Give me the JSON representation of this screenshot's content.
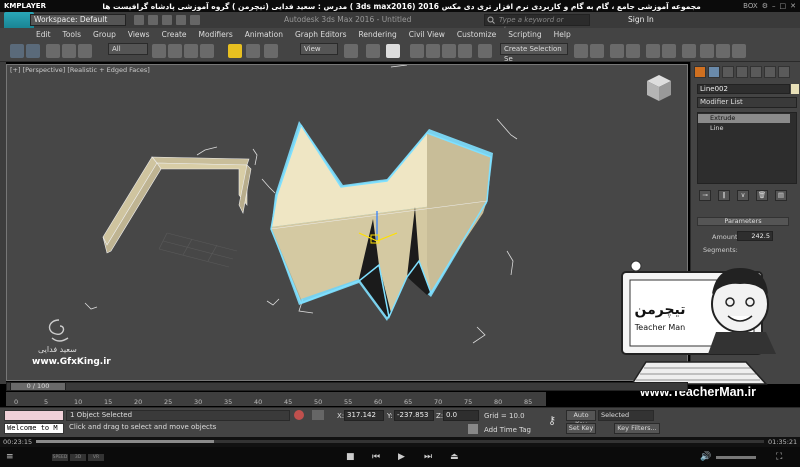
{
  "kmplayer": {
    "logo": "KMPLAYER",
    "video_title": "مجموعه آموزشی جامع ، گام به گام و کاربردی نرم افزار تری دی مکس 2016 (3ds max2016 ) مدرس : سعید فدایی (تیچرمن ) گروه آموزشی پادشاه گرافیست ها",
    "controls": [
      "BOX",
      "⚙",
      "–",
      "□",
      "✕"
    ],
    "time_elapsed": "00:23:15",
    "time_total": "01:35:21",
    "progress": 0.245,
    "chips": [
      "SPEED",
      "3D",
      "VR",
      "SUB"
    ]
  },
  "app": {
    "logo": "MAX",
    "workspace": "Workspace: Default",
    "title": "Autodesk 3ds Max 2016 - Untitled",
    "search_placeholder": "Type a keyword or phrase",
    "sign_in": "Sign In"
  },
  "menu": [
    "Edit",
    "Tools",
    "Group",
    "Views",
    "Create",
    "Modifiers",
    "Animation",
    "Graph Editors",
    "Rendering",
    "Civil View",
    "Customize",
    "Scripting",
    "Help"
  ],
  "toolbar": {
    "filter": "All",
    "coord_system": "View",
    "named_selection": "Create Selection Se"
  },
  "viewport": {
    "label": "[+] [Perspective] [Realistic + Edged Faces]"
  },
  "command_panel": {
    "object_name": "Line002",
    "modifier_list": "Modifier List",
    "stack": [
      "Extrude",
      "Line"
    ],
    "parameters_header": "Parameters",
    "amount_label": "Amount:",
    "amount_value": "242.5",
    "segments_label": "Segments:"
  },
  "timeline": {
    "frame_display": "0 / 100",
    "ticks": [
      "0",
      "5",
      "10",
      "15",
      "20",
      "25",
      "30",
      "35",
      "40",
      "45",
      "50",
      "55",
      "60",
      "65",
      "70",
      "75",
      "80",
      "85"
    ]
  },
  "status": {
    "welcome": "Welcome to M",
    "selection": "1 Object Selected",
    "prompt": "Click and drag to select and move objects",
    "x_label": "X:",
    "x_value": "317.142",
    "y_label": "Y:",
    "y_value": "-237.853",
    "z_label": "Z:",
    "z_value": "0.0",
    "grid": "Grid = 10.0",
    "add_time_tag": "Add Time Tag",
    "auto_key": "Auto Key",
    "set_key": "Set Key",
    "selected": "Selected",
    "key_filters": "Key Filters..."
  },
  "overlay": {
    "author_name": "سعید فدایی",
    "author_site": "www.GfxKing.ir",
    "teacher_logo": "تیچرمن",
    "teacher_subtitle": "Teacher Man",
    "teacher_url": "www.TeacherMan.ir"
  },
  "colors": {
    "accent_teal": "#2aa7b8",
    "extrude_face": "#efe6c4",
    "selection_outline": "#7fe0ff",
    "gizmo_yellow": "#ffe000",
    "auto_key_red": "#c04040"
  }
}
